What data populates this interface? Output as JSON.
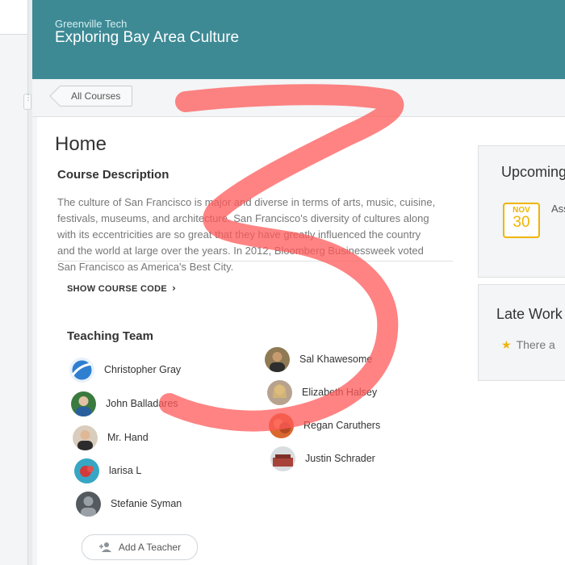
{
  "header": {
    "org_name": "Greenville Tech",
    "course_title": "Exploring Bay Area Culture"
  },
  "breadcrumb": {
    "all_courses_label": "All Courses"
  },
  "main": {
    "page_title": "Home",
    "course_description_heading": "Course Description",
    "course_description_text": "The culture of San Francisco is major and diverse in terms of arts, music, cuisine, festivals, museums, and architecture. San Francisco's diversity of cultures along with its eccentricities are so great that they have greatly influenced the country and the world at large over the years. In 2012, Bloomberg Businessweek voted San Francisco as America's Best City.",
    "show_course_code_label": "SHOW COURSE CODE",
    "teaching_team_heading": "Teaching Team",
    "teaching_team_left": [
      {
        "name": "Christopher Gray",
        "avatar_color": "#2f7fd0"
      },
      {
        "name": "John Balladares",
        "avatar_color": "#3b7a3f"
      },
      {
        "name": "Mr. Hand",
        "avatar_color": "#c9b49a"
      },
      {
        "name": "larisa L",
        "avatar_color": "#d23a3a"
      },
      {
        "name": "Stefanie Syman",
        "avatar_color": "#555a5e"
      }
    ],
    "teaching_team_right": [
      {
        "name": "Sal Khawesome",
        "avatar_color": "#6b5a3e"
      },
      {
        "name": "Elizabeth Halsey",
        "avatar_color": "#c7a07f"
      },
      {
        "name": "Regan Caruthers",
        "avatar_color": "#d9682e"
      },
      {
        "name": "Justin Schrader",
        "avatar_color": "#a8433a"
      }
    ],
    "add_teacher_label": "Add A Teacher"
  },
  "sidebar": {
    "upcoming_title": "Upcoming",
    "upcoming_month": "NOV",
    "upcoming_day": "30",
    "upcoming_item_text": "Assig",
    "late_work_title": "Late Work",
    "late_work_text": "There a"
  },
  "colors": {
    "header_bg": "#3d8a95",
    "accent_yellow": "#f0b400",
    "annotation_red": "#ff5a5a"
  }
}
